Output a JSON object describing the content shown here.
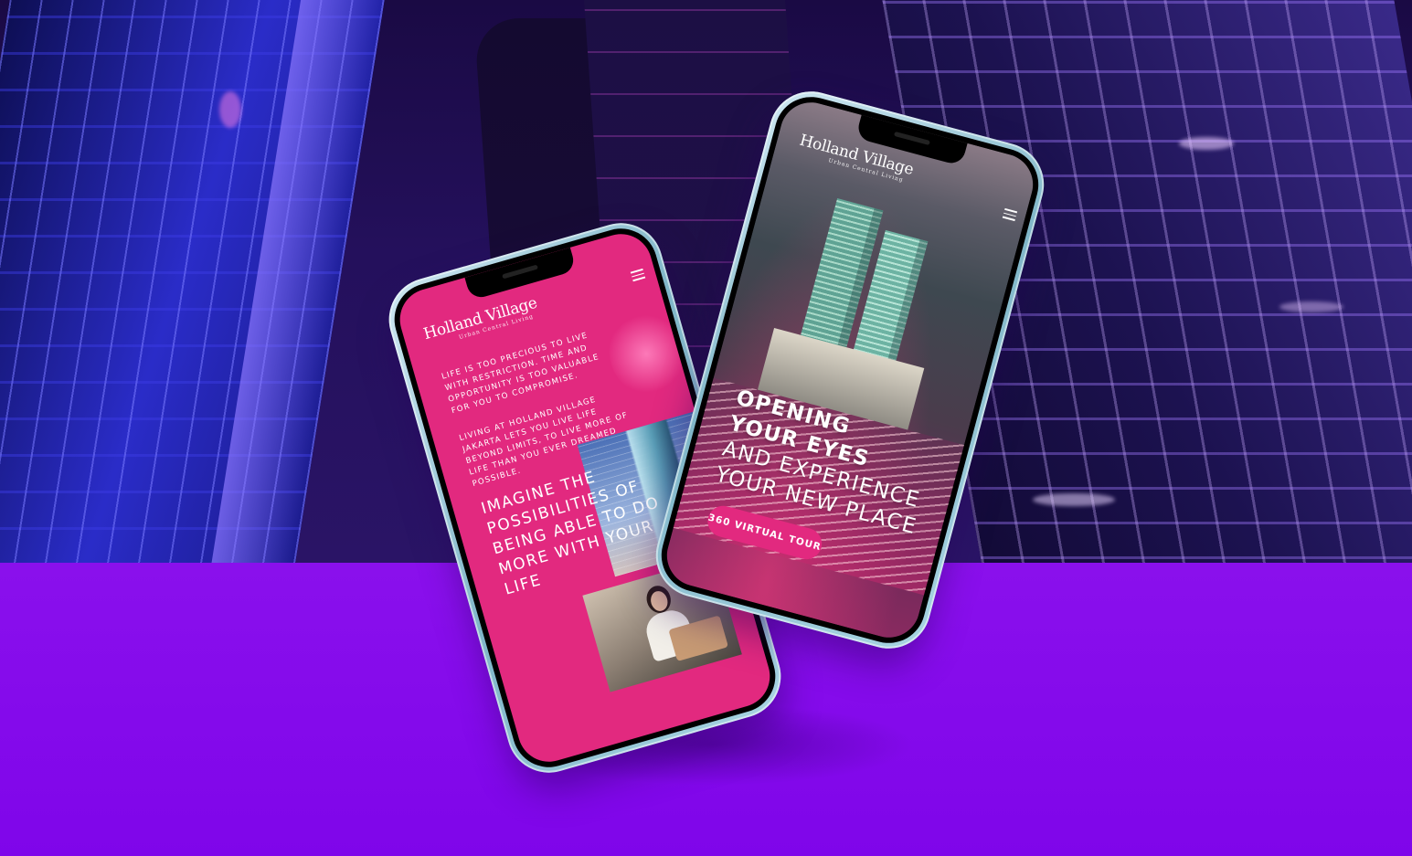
{
  "colors": {
    "floor": "#7f05ea",
    "brand_pink": "#e2297f",
    "phone_frame": "#8fc4d4"
  },
  "phone_left": {
    "logo_main": "Holland Village",
    "logo_sub": "Urban Central Living",
    "menu_icon": "hamburger-menu-icon",
    "paragraph_1": "LIFE IS TOO PRECIOUS TO LIVE WITH RESTRICTION. TIME AND OPPORTUNITY IS TOO VALUABLE FOR YOU TO COMPROMISE.",
    "paragraph_2": "LIVING AT HOLLAND VILLAGE JAKARTA LETS YOU LIVE LIFE BEYOND LIMITS, TO LIVE MORE OF LIFE THAN YOU EVER DREAMED POSSIBLE.",
    "headline": "IMAGINE THE POSSIBILITIES OF BEING ABLE TO DO MORE WITH YOUR LIFE"
  },
  "phone_right": {
    "logo_main": "Holland Village",
    "logo_sub": "Urban Central Living",
    "menu_icon": "hamburger-menu-icon",
    "headline_bold_1": "OPENING",
    "headline_bold_2": "YOUR EYES",
    "headline_reg_1": "AND EXPERIENCE",
    "headline_reg_2": "YOUR NEW PLACE",
    "cta_label": "360 VIRTUAL TOUR"
  }
}
